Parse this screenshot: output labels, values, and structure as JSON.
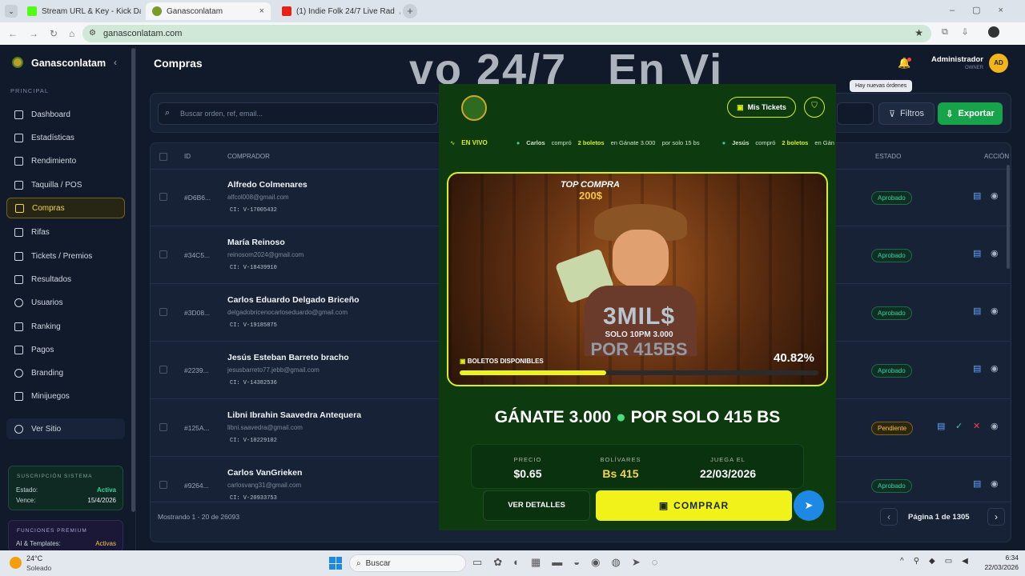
{
  "browser": {
    "tabs": [
      {
        "title": "Stream URL & Key - Kick Dashb"
      },
      {
        "title": "Ganasconlatam"
      },
      {
        "title": "(1) Indie Folk 24/7 Live Rad"
      }
    ],
    "url": "ganasconlatam.com"
  },
  "sidebar": {
    "brand": "Ganasconlatam",
    "section": "PRINCIPAL",
    "items": [
      "Dashboard",
      "Estadísticas",
      "Rendimiento",
      "Taquilla / POS",
      "Compras",
      "Rifas",
      "Tickets / Premios",
      "Resultados",
      "Usuarios",
      "Ranking",
      "Pagos",
      "Branding",
      "Minijuegos"
    ],
    "ver_sitio": "Ver Sitio",
    "subscription": {
      "title": "SUSCRIPCIÓN SISTEMA",
      "estado_label": "Estado:",
      "estado": "Activa",
      "vence_label": "Vence:",
      "vence": "15/4/2026"
    },
    "premium": {
      "title": "FUNCIONES PREMIUM",
      "ai_label": "AI & Templates:",
      "ai": "Activas"
    }
  },
  "header": {
    "title": "Compras",
    "user": "Administrador",
    "role": "OWNER",
    "avatar": "AD",
    "tooltip": "Hay nuevas órdenes",
    "bg_text": "vo 24/7   En Vi"
  },
  "toolbar": {
    "search_placeholder": "Buscar orden, ref, email...",
    "filters": "Filtros",
    "export": "Exportar"
  },
  "table": {
    "headers": {
      "id": "ID",
      "buyer": "COMPRADOR",
      "status": "ESTADO",
      "action": "ACCIÓN"
    },
    "rows": [
      {
        "id": "#D6B6...",
        "name": "Alfredo Colmenares",
        "email": "alfcol008@gmail.com",
        "ci": "CI: V-17005432",
        "status": "Aprobado"
      },
      {
        "id": "#34C5...",
        "name": "María Reinoso",
        "email": "reinosom2024@gmail.com",
        "ci": "CI: V-18439910",
        "status": "Aprobado"
      },
      {
        "id": "#3D08...",
        "name": "Carlos Eduardo Delgado Briceño",
        "email": "delgadobricenocarloseduardo@gmail.com",
        "ci": "CI: V-19185875",
        "status": "Aprobado"
      },
      {
        "id": "#2239...",
        "name": "Jesús Esteban Barreto bracho",
        "email": "jesusbarreto77.jebb@gmail.com",
        "ci": "CI: V-14382536",
        "status": "Aprobado"
      },
      {
        "id": "#125A...",
        "name": "Libni Ibrahin Saavedra Antequera",
        "email": "libni.saavedra@gmail.com",
        "ci": "CI: V-10229102",
        "status": "Pendiente"
      },
      {
        "id": "#9264...",
        "name": "Carlos VanGrieken",
        "email": "carlosvang31@gmail.com",
        "ci": "CI: V-20933753",
        "status": "Aprobado"
      }
    ],
    "footer": "Mostrando 1 - 20 de 26093",
    "page": "Página 1 de 1305"
  },
  "modal": {
    "my_tickets": "Mis Tickets",
    "live": "EN VIVO",
    "ticker": [
      "Carlos",
      "compró",
      "2 boletos",
      "en Gánate 3.000",
      "por solo 15 bs",
      "Jesús",
      "compró",
      "2 boletos",
      "en Gán"
    ],
    "banner": {
      "top": "TOP COMPRA",
      "top_amount": "200$",
      "big": "3MIL$",
      "sub": "SOLO 10PM 3.000",
      "por": "POR 415BS",
      "available_label": "BOLETOS DISPONIBLES",
      "percent": "40.82%",
      "progress": 0.4082
    },
    "headline": "GÁNATE 3.000",
    "headline2": "POR SOLO 415 BS",
    "stats": [
      {
        "label": "PRECIO",
        "value": "$0.65"
      },
      {
        "label": "BOLÍVARES",
        "value": "Bs 415"
      },
      {
        "label": "JUEGA EL",
        "value": "22/03/2026"
      }
    ],
    "details": "VER DETALLES",
    "buy": "COMPRAR"
  },
  "taskbar": {
    "temp": "24°C",
    "weather": "Soleado",
    "search": "Buscar",
    "time": "6:34",
    "date": "22/03/2026"
  }
}
